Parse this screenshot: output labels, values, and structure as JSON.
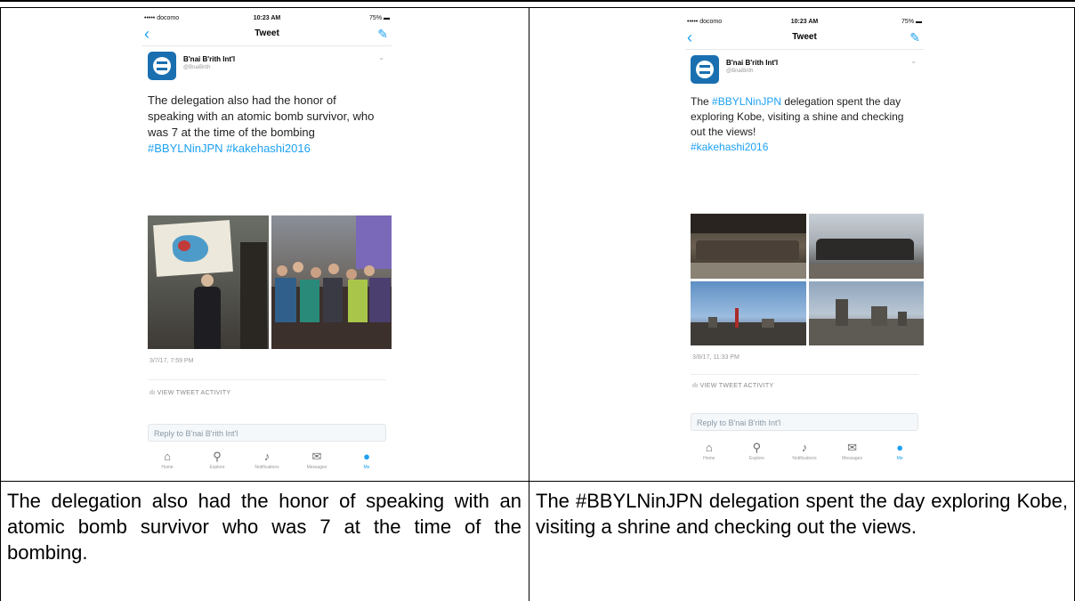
{
  "left": {
    "status": {
      "carrier": "••••• docomo",
      "time": "10:23 AM",
      "battery": "75%"
    },
    "nav_title": "Tweet",
    "author_name": "B'nai B'rith Int'l",
    "author_handle": "@BnaiBrith",
    "tweet_body": "The delegation also had the honor of speaking with an atomic bomb survivor, who was 7 at the time of the bombing",
    "tweet_tags": "#BBYLNinJPN #kakehashi2016",
    "timestamp": "3/7/17, 7:59 PM",
    "activity": "VIEW TWEET ACTIVITY",
    "reply_placeholder": "Reply to B'nai B'rith Int'l",
    "caption": "The delegation also had the honor of speaking with an atomic bomb survivor who was 7 at the time of the bombing."
  },
  "right": {
    "status": {
      "carrier": "••••• docomo",
      "time": "10:23 AM",
      "battery": "75%"
    },
    "nav_title": "Tweet",
    "author_name": "B'nai B'rith Int'l",
    "author_handle": "@BnaiBrith",
    "tweet_prefix": "The ",
    "tweet_tag1": "#BBYLNinJPN",
    "tweet_body": " delegation spent the day exploring Kobe, visiting a shine and checking out the views!",
    "tweet_tag2": "#kakehashi2016",
    "timestamp": "3/8/17, 11:33 PM",
    "activity": "VIEW TWEET ACTIVITY",
    "reply_placeholder": "Reply to B'nai B'rith Int'l",
    "caption": "The #BBYLNinJPN delegation spent the day exploring Kobe, visiting a shrine and checking out the views."
  },
  "tabs": [
    "Home",
    "Explore",
    "Notifications",
    "Messages",
    "Me"
  ],
  "tab_icons": [
    "home-icon",
    "search-icon",
    "bell-icon",
    "envelope-icon",
    "person-icon"
  ],
  "colors": {
    "link": "#1da1f2",
    "avatar": "#1a6fb0"
  }
}
